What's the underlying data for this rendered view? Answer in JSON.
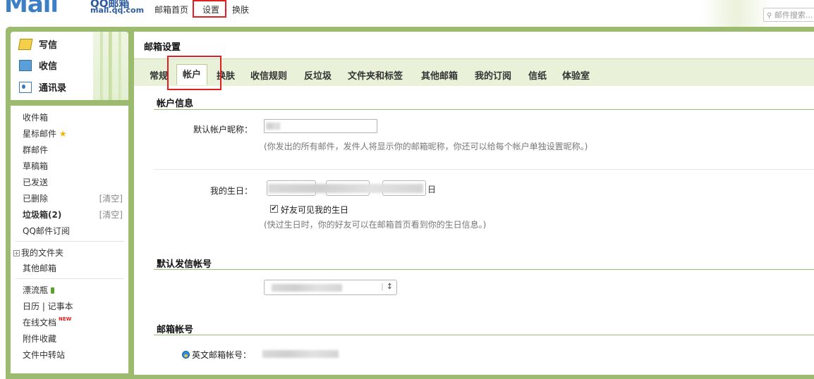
{
  "header": {
    "logo_text": "Mail",
    "brand_name": "QQ邮箱",
    "brand_url": "mail.qq.com",
    "nav": [
      "邮箱首页",
      "设置",
      "换肤"
    ],
    "nav_sep": "-",
    "search_placeholder": "邮件搜索..."
  },
  "sidebar": {
    "quick": [
      {
        "label": "写信",
        "icon": "pencil-paper-icon"
      },
      {
        "label": "收信",
        "icon": "inbox-download-icon"
      },
      {
        "label": "通讯录",
        "icon": "contact-card-icon"
      }
    ],
    "folders": [
      {
        "label": "收件箱"
      },
      {
        "label": "星标邮件",
        "icon": "star-icon"
      },
      {
        "label": "群邮件"
      },
      {
        "label": "草稿箱"
      },
      {
        "label": "已发送"
      },
      {
        "label": "已删除",
        "action": "[清空]"
      },
      {
        "label": "垃圾箱(2)",
        "action": "[清空]"
      },
      {
        "label": "QQ邮件订阅"
      }
    ],
    "my_folders": "我的文件夹",
    "other_mail": "其他邮箱",
    "apps": [
      {
        "label": "漂流瓶",
        "icon": "bottle-icon"
      },
      {
        "label": "日历 | 记事本"
      },
      {
        "label": "在线文档",
        "badge": "NEW"
      },
      {
        "label": "附件收藏"
      },
      {
        "label": "文件中转站"
      }
    ]
  },
  "main": {
    "title": "邮箱设置",
    "tabs": [
      "常规",
      "帐户",
      "换肤",
      "收信规则",
      "反垃圾",
      "文件夹和标签",
      "其他邮箱",
      "我的订阅",
      "信纸",
      "体验室"
    ],
    "active_tab": "帐户",
    "account_info": {
      "heading": "帐户信息",
      "nickname_label": "默认帐户昵称：",
      "nickname_hint": "(你发出的所有邮件，发件人将显示你的邮箱昵称，你还可以给每个帐户单独设置昵称。)",
      "birthday_label": "我的生日：",
      "day_sep": "日",
      "birthday_visible_label": "好友可见我的生日",
      "birthday_visible_checked": true,
      "birthday_hint": "(快过生日时，你的好友可以在邮箱首页看到你的生日信息。)"
    },
    "default_sender": {
      "heading": "默认发信帐号"
    },
    "mail_account": {
      "heading": "邮箱帐号",
      "english_label": "英文邮箱帐号："
    }
  },
  "colors": {
    "frame_green": "#9dbb6e",
    "tabbar_bg": "#e9f1d9",
    "highlight_red": "#e02020",
    "logo_blue": "#3d7fc5"
  }
}
